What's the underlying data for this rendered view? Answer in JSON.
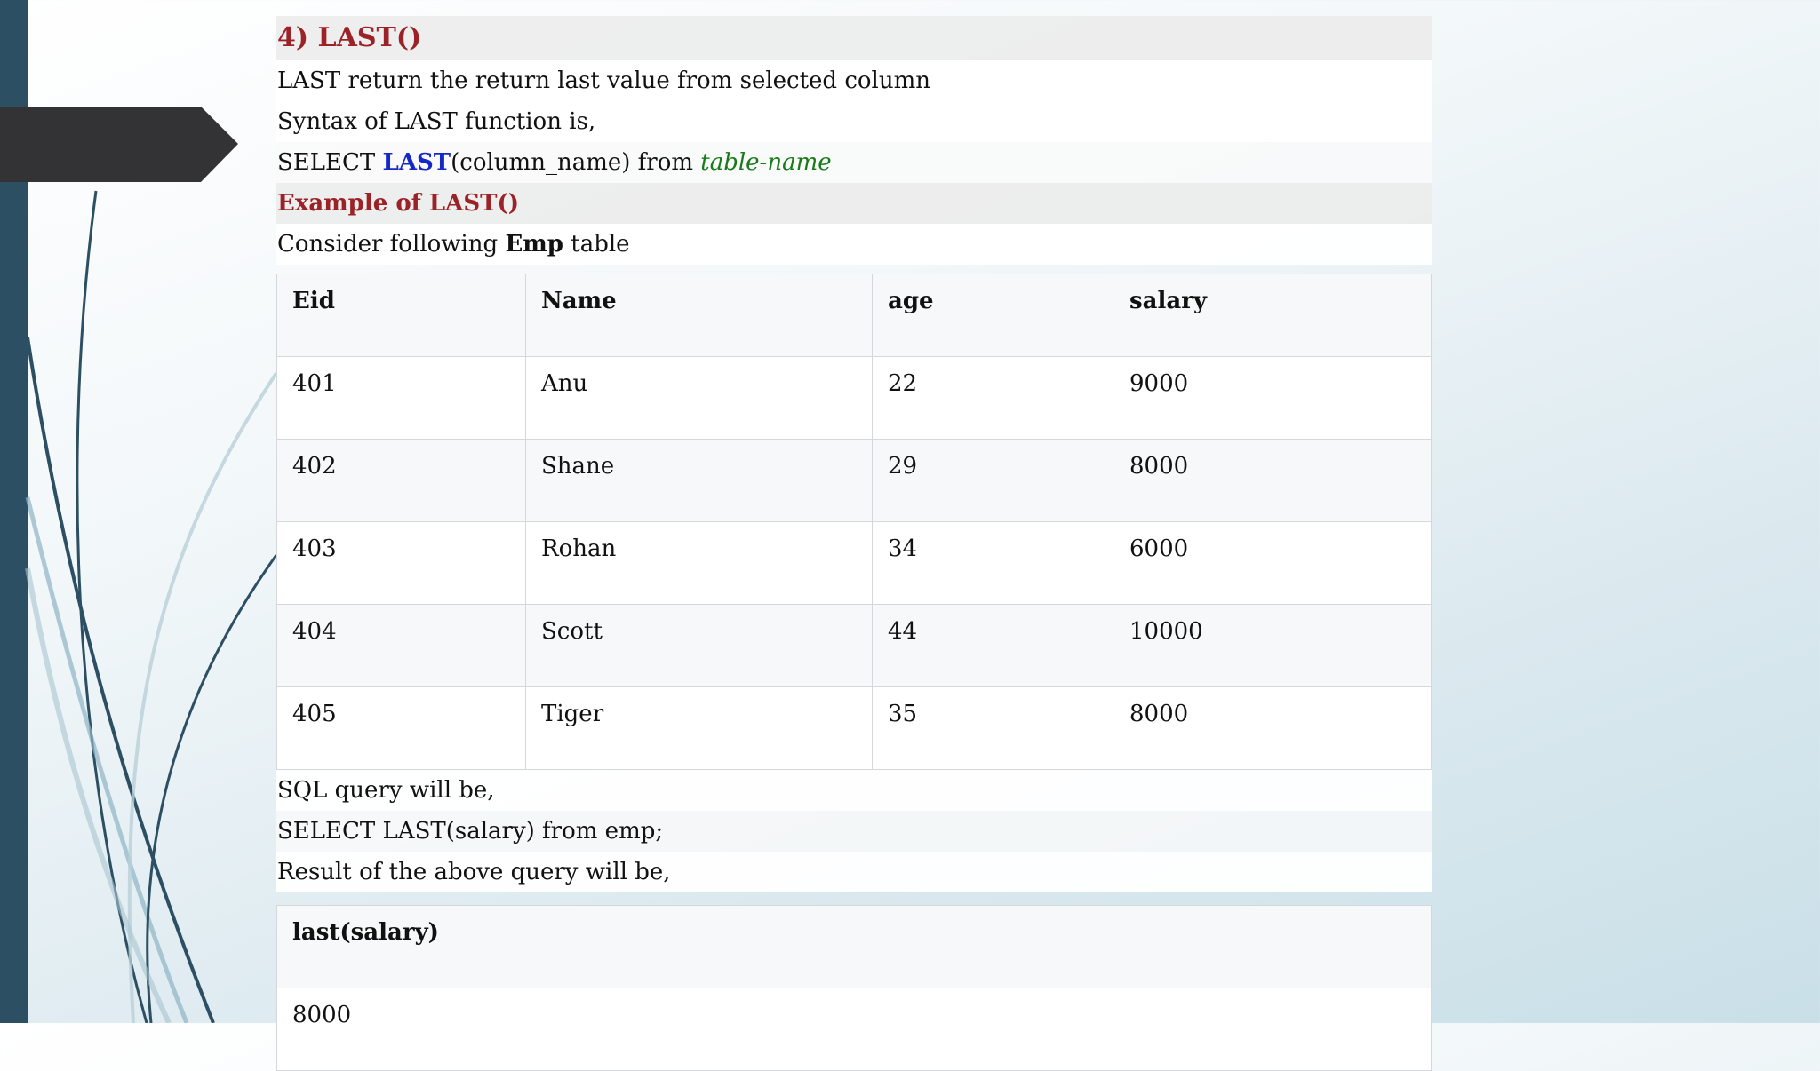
{
  "heading": "4) LAST()",
  "description": "LAST return the return last value from selected column",
  "syntax_intro": "Syntax of LAST function is,",
  "syntax": {
    "select": "SELECT ",
    "fn": "LAST",
    "mid": "(column_name) from ",
    "table": "table-name"
  },
  "example_heading": "Example of LAST()",
  "consider": {
    "prefix": "Consider following ",
    "table": "Emp",
    "suffix": " table"
  },
  "emp_table": {
    "headers": [
      "Eid",
      "Name",
      "age",
      "salary"
    ],
    "rows": [
      [
        "401",
        "Anu",
        "22",
        "9000"
      ],
      [
        "402",
        "Shane",
        "29",
        "8000"
      ],
      [
        "403",
        "Rohan",
        "34",
        "6000"
      ],
      [
        "404",
        "Scott",
        "44",
        "10000"
      ],
      [
        "405",
        "Tiger",
        "35",
        "8000"
      ]
    ]
  },
  "query_intro": "SQL query will be,",
  "query": "SELECT LAST(salary) from emp;",
  "result_intro": "Result of the above query will be,",
  "result_table": {
    "header": "last(salary)",
    "value": "8000"
  }
}
